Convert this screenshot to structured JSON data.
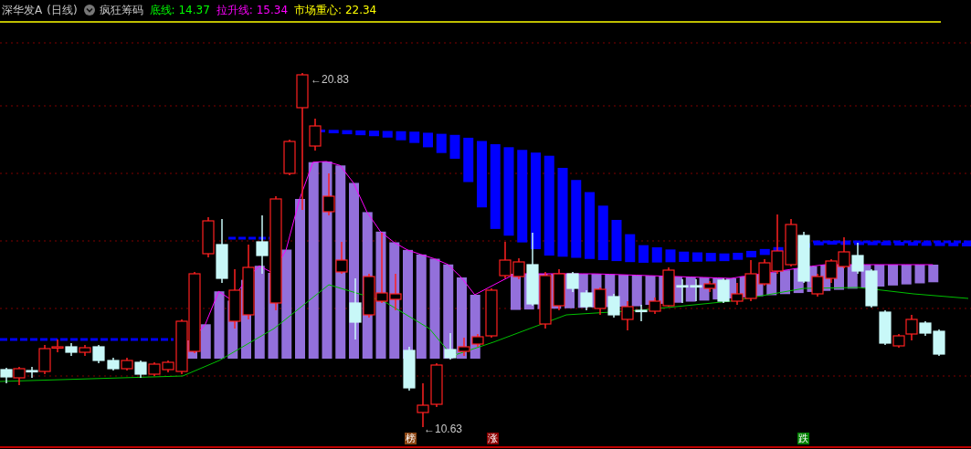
{
  "header": {
    "stock_name": "深华发A",
    "period": "(日线)",
    "indicator": "疯狂筹码",
    "stats": [
      {
        "label": "底线:",
        "value": "14.37",
        "color": "#00ff00"
      },
      {
        "label": "拉升线:",
        "value": "15.34",
        "color": "#ff00ff"
      },
      {
        "label": "市场重心:",
        "value": "22.34",
        "color": "#ffff00"
      }
    ]
  },
  "chart": {
    "high_label": "←20.83",
    "low_label": "←10.63",
    "markers": [
      {
        "text": "榜",
        "color": "#8b4513"
      },
      {
        "text": "涨",
        "color": "#8b0000"
      },
      {
        "text": "跌",
        "color": "#008000"
      }
    ]
  }
}
